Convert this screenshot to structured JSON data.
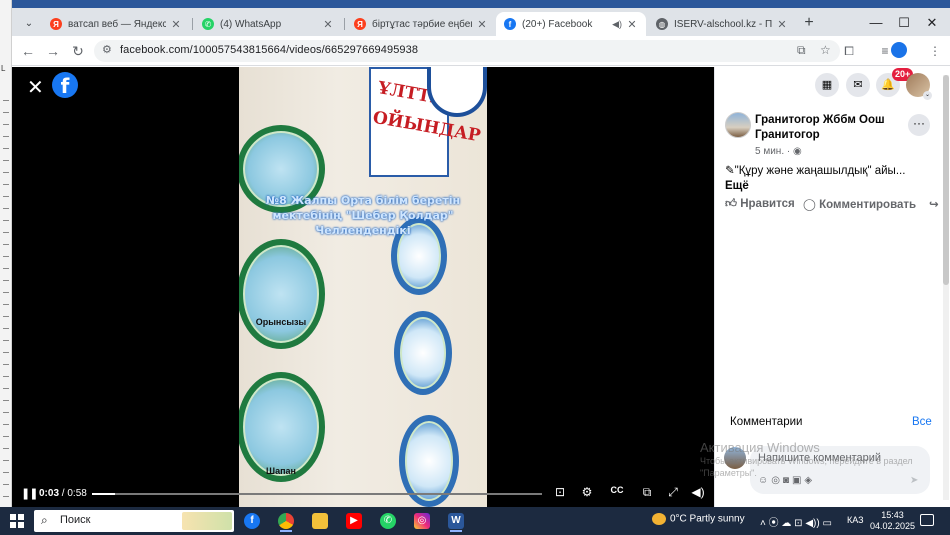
{
  "browser": {
    "tabs": [
      {
        "title": "ватсап веб — Яндекс: наш",
        "favicon": "yandex-icon",
        "color": "#fc3f1d",
        "active": false
      },
      {
        "title": "(4) WhatsApp",
        "favicon": "whatsapp-icon",
        "color": "#25d366",
        "active": false
      },
      {
        "title": "біртұтас тәрбие еңбегі ада",
        "favicon": "yandex-icon",
        "color": "#fc3f1d",
        "active": false
      },
      {
        "title": "(20+) Facebook",
        "favicon": "facebook-icon",
        "color": "#1877f2",
        "active": true
      },
      {
        "title": "ISERV-alschool.kz - Панель",
        "favicon": "globe-icon",
        "color": "#5f6368",
        "active": false
      }
    ],
    "url": "facebook.com/100057543815664/videos/665297669495938"
  },
  "video": {
    "caption": "№8 Жалпы Орта білім беретін мектебінің \"Шебер Қолдар\" Челлендендікі",
    "sign_text": "ҰЛТТЫҚ ОЙЫНДАР",
    "plate_labels": [
      "Орынсызы",
      "Шапан"
    ],
    "time_current": "0:03",
    "time_total": "0:58",
    "progress_fraction": 0.052
  },
  "panel": {
    "notification_count": "20+",
    "page_name": "Гранитогор Жббм Оош Гранитогор",
    "post_age": "5 мин. · ",
    "post_text": "\"Құру және жаңашылдық\" айы...",
    "post_more": "Ещё",
    "like_label": "Нравится",
    "comment_label": "Комментировать",
    "comments_title": "Комментарии",
    "comments_all": "Все",
    "comment_placeholder": "Напишите комментарий"
  },
  "watermark": {
    "title": "Активация Windows",
    "subtitle": "Чтобы активировать Windows, перейдите в раздел \"Параметры\"."
  },
  "taskbar": {
    "search_text": "Поиск",
    "weather": "0°C  Partly sunny",
    "language": "КАЗ",
    "time": "15:43",
    "date": "04.02.2025"
  }
}
